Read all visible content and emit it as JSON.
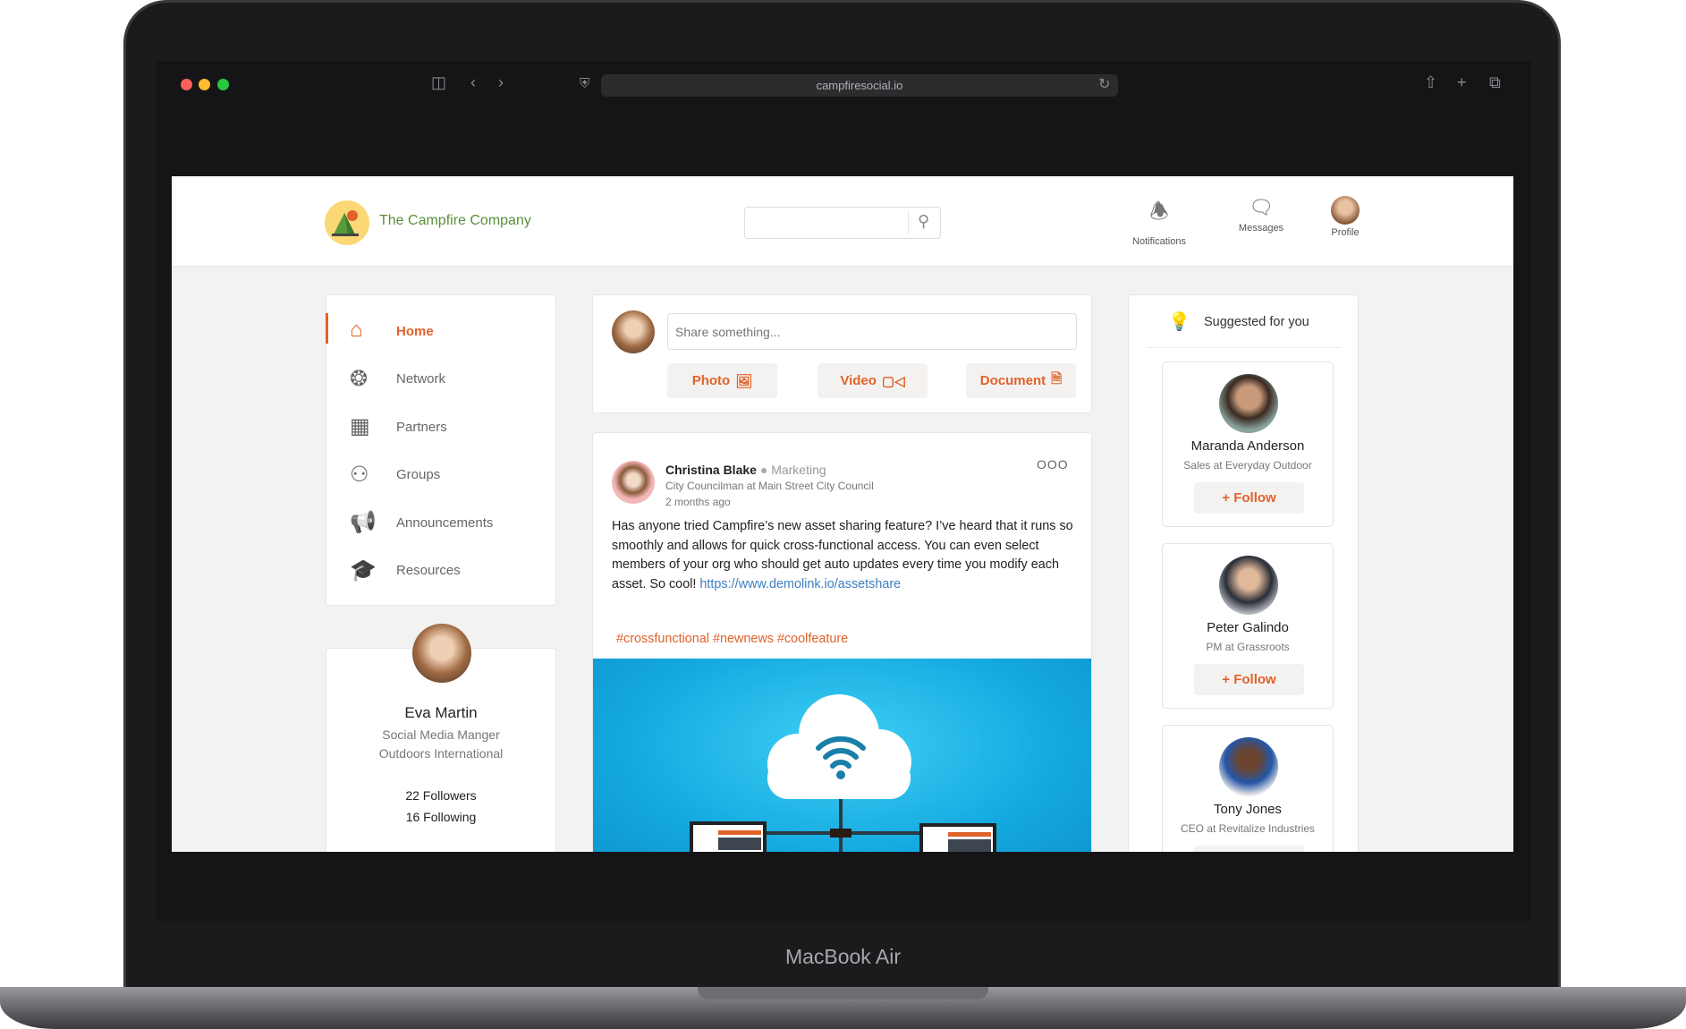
{
  "browser": {
    "url": "campfiresocial.io"
  },
  "device": {
    "label": "MacBook Air"
  },
  "header": {
    "brand": "The Campfire Company",
    "search_placeholder": "",
    "notifications": "Notifications",
    "messages": "Messages",
    "profile": "Profile"
  },
  "sidebar": {
    "items": [
      {
        "label": "Home",
        "icon": "home-icon",
        "active": true
      },
      {
        "label": "Network",
        "icon": "network-icon"
      },
      {
        "label": "Partners",
        "icon": "partners-icon"
      },
      {
        "label": "Groups",
        "icon": "groups-icon"
      },
      {
        "label": "Announcements",
        "icon": "megaphone-icon"
      },
      {
        "label": "Resources",
        "icon": "graduation-cap-icon"
      }
    ]
  },
  "profile_card": {
    "name": "Eva Martin",
    "title": "Social Media Manger",
    "company": "Outdoors International",
    "followers": "22 Followers",
    "following": "16 Following"
  },
  "composer": {
    "placeholder": "Share something...",
    "photo": "Photo",
    "video": "Video",
    "document": "Document"
  },
  "post": {
    "author": "Christina Blake",
    "department": "Marketing",
    "subtitle": "City Councilman at Main Street City Council",
    "time": "2 months ago",
    "body": "Has anyone tried Campfire’s new asset sharing feature? I’ve heard that it runs so smoothly and allows for quick cross-functional access. You can even select members of your org who should get auto updates every time you modify each asset. So cool! ",
    "link": "https://www.demolink.io/assetshare",
    "hashtags": "#crossfunctional #newnews #coolfeature",
    "more": "OOO"
  },
  "suggested": {
    "title": "Suggested for you",
    "follow_label": "+ Follow",
    "people": [
      {
        "name": "Maranda Anderson",
        "role": "Sales at Everyday Outdoor"
      },
      {
        "name": "Peter Galindo",
        "role": "PM at Grassroots"
      },
      {
        "name": "Tony Jones",
        "role": "CEO at Revitalize Industries"
      }
    ]
  },
  "colors": {
    "accent": "#e0622a",
    "brand_green": "#5a8f3c",
    "link": "#3f7fc1",
    "image_bg": "#14a9e0"
  }
}
